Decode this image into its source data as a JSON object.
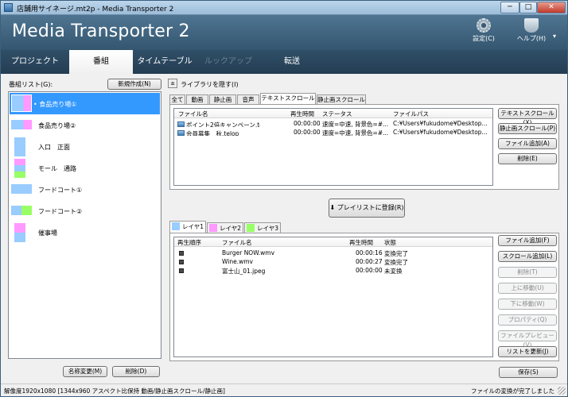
{
  "window": {
    "title": "店舗用サイネージ.mt2p - Media Transporter 2",
    "min_glyph": "─",
    "max_glyph": "□",
    "close_glyph": "✕"
  },
  "header": {
    "brand": "Media Transporter 2",
    "settings_label": "設定(C)",
    "help_label": "ヘルプ(H)",
    "help_chevron": "▾"
  },
  "main_tabs": [
    {
      "label": "プロジェクト",
      "state": "normal"
    },
    {
      "label": "番組",
      "state": "active"
    },
    {
      "label": "タイムテーブル",
      "state": "normal"
    },
    {
      "label": "ルックアップ",
      "state": "disabled"
    },
    {
      "label": "転送",
      "state": "normal"
    }
  ],
  "program_list": {
    "label": "番組リスト(G):",
    "new_button": "新規作成(N)",
    "items": [
      {
        "name": "食品売り場①",
        "selected": true,
        "marker": "•"
      },
      {
        "name": "食品売り場②",
        "selected": false
      },
      {
        "name": "入口　正面",
        "selected": false
      },
      {
        "name": "モール　通路",
        "selected": false
      },
      {
        "name": "フードコート①",
        "selected": false
      },
      {
        "name": "フードコート②",
        "selected": false
      },
      {
        "name": "催事場",
        "selected": false
      }
    ],
    "rename_button": "名称変更(M)",
    "delete_button": "削除(D)"
  },
  "library": {
    "toggle_glyph": "±",
    "hide_label": "ライブラリを隠す(I)",
    "tabs": [
      "全て",
      "動画",
      "静止画",
      "音声",
      "テキストスクロール",
      "静止画スクロール"
    ],
    "active_tab": 4,
    "columns": [
      "ファイル名",
      "再生時間",
      "ステータス",
      "ファイルパス"
    ],
    "rows": [
      {
        "name": "ポイント2倍キャンペーン.tel...",
        "duration": "00:00:00",
        "status": "速度=中速, 背景色=#...",
        "path": "C:¥Users¥fukudome¥Desktop..."
      },
      {
        "name": "会員募集　秋.telop",
        "duration": "00:00:00",
        "status": "速度=中速, 背景色=#...",
        "path": "C:¥Users¥fukudome¥Desktop..."
      }
    ],
    "buttons": [
      "テキストスクロール(X)",
      "静止画スクロール(P)",
      "ファイル追加(A)",
      "削除(E)"
    ]
  },
  "register_button": "プレイリストに登録(R)",
  "register_glyph": "⬇",
  "playlist": {
    "layers": [
      {
        "label": "レイヤ1",
        "color": "#99ccff"
      },
      {
        "label": "レイヤ2",
        "color": "#ff99ff"
      },
      {
        "label": "レイヤ3",
        "color": "#99ff66"
      }
    ],
    "active_layer": 0,
    "columns": [
      "再生順序",
      "ファイル名",
      "再生時間",
      "状態"
    ],
    "rows": [
      {
        "order": "001",
        "name": "Burger NOW.wmv",
        "duration": "00:00:16",
        "state": "変換完了"
      },
      {
        "order": "002",
        "name": "Wine.wmv",
        "duration": "00:00:27",
        "state": "変換完了"
      },
      {
        "order": "003",
        "name": "富士山_01.jpeg",
        "duration": "00:00:00",
        "state": "未変換"
      }
    ],
    "buttons": [
      {
        "label": "ファイル追加(F)",
        "enabled": true
      },
      {
        "label": "スクロール追加(L)",
        "enabled": true
      },
      {
        "label": "削除(T)",
        "enabled": false
      },
      {
        "label": "上に移動(U)",
        "enabled": false
      },
      {
        "label": "下に移動(W)",
        "enabled": false
      },
      {
        "label": "プロパティ(Q)",
        "enabled": false
      },
      {
        "label": "ファイルプレビュー(V)",
        "enabled": false
      },
      {
        "label": "リストを更新(J)",
        "enabled": true
      }
    ],
    "save_button": "保存(S)"
  },
  "status": {
    "left": "解像度1920x1080 [1344x960 アスペクト比保持 動画/静止画スクロール/静止画]",
    "right": "ファイルの変換が完了しました"
  },
  "colors": {
    "header_bg": "#3d6079",
    "tabbar_bg": "#2a465c",
    "selection": "#3399ff",
    "layer1": "#99ccff",
    "layer2": "#ff99ff",
    "layer3": "#99ff66"
  }
}
